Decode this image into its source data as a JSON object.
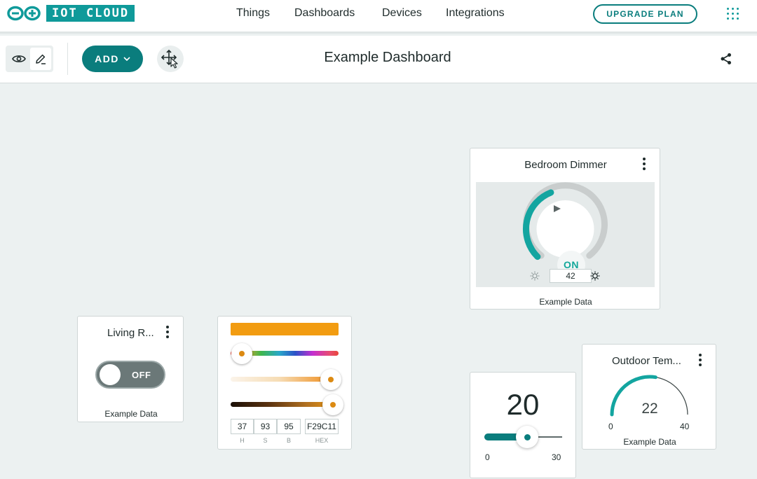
{
  "brand": {
    "text": "IOT CLOUD",
    "color": "#0f9a9a"
  },
  "nav": {
    "things": "Things",
    "dashboards": "Dashboards",
    "devices": "Devices",
    "integrations": "Integrations"
  },
  "upgrade_label": "UPGRADE PLAN",
  "toolbar": {
    "add_label": "ADD",
    "title": "Example Dashboard"
  },
  "icons": [
    "eye-icon",
    "edit-icon",
    "chevron-down-icon",
    "arrange-move-icon",
    "share-icon",
    "apps-grid-icon",
    "kebab-menu-icon",
    "sun-dim-icon",
    "sun-bright-icon"
  ],
  "colors": {
    "accent": "#0a7d7d",
    "teal": "#12a79a",
    "picked": "#F29C11"
  },
  "widgets": {
    "dimmer": {
      "title": "Bedroom Dimmer",
      "button": "ON",
      "value": "42",
      "percent": 42,
      "caption": "Example Data"
    },
    "switch": {
      "title": "Living R...",
      "state": "OFF",
      "caption": "Example Data"
    },
    "color": {
      "h": "37",
      "s": "93",
      "b": "95",
      "hex": "F29C11",
      "labels": {
        "h": "H",
        "s": "S",
        "b": "B",
        "hex": "HEX"
      }
    },
    "slider": {
      "value": "20",
      "min": "0",
      "max": "30",
      "value_num": 20,
      "min_num": 0,
      "max_num": 30
    },
    "gauge": {
      "title": "Outdoor Tem...",
      "value": "22",
      "min": "0",
      "max": "40",
      "caption": "Example Data",
      "value_num": 22,
      "min_num": 0,
      "max_num": 40
    }
  }
}
